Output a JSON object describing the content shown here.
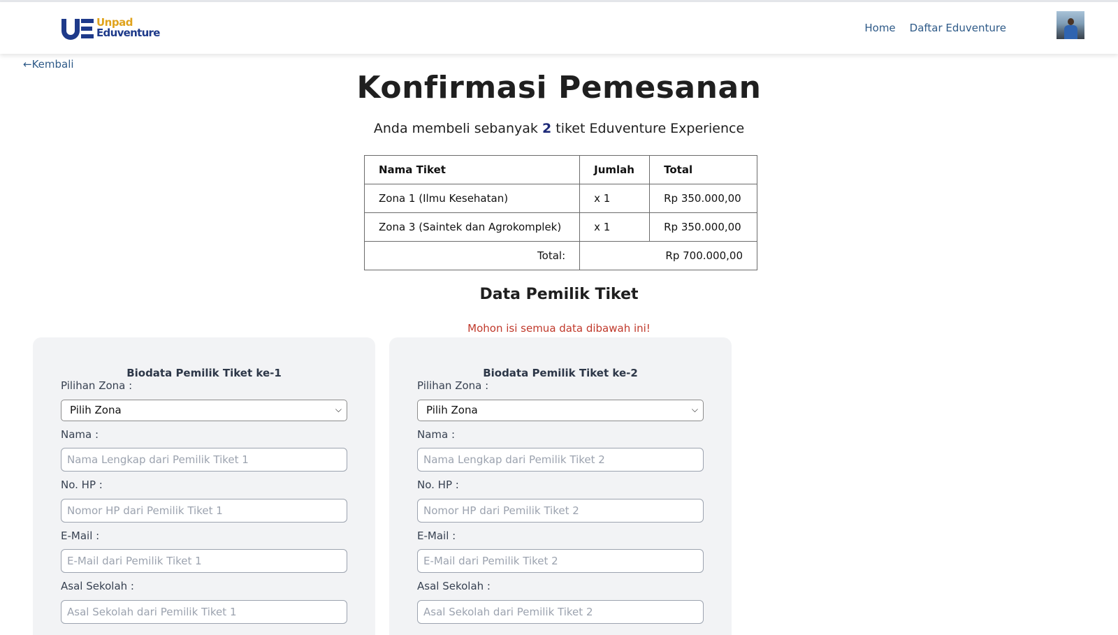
{
  "header": {
    "logo": {
      "line1": "Unpad",
      "line2": "Eduventure",
      "mark_text": "UE"
    },
    "nav": [
      "Home",
      "Daftar Eduventure"
    ]
  },
  "back_link": "←Kembali",
  "page_title": "Konfirmasi Pemesanan",
  "subtitle": {
    "before": "Anda membeli sebanyak",
    "quantity": "2",
    "after": "tiket Eduventure Experience"
  },
  "summary_table": {
    "headers": [
      "Nama Tiket",
      "Jumlah",
      "Total"
    ],
    "rows": [
      {
        "name": "Zona 1 (Ilmu Kesehatan)",
        "qty": "x 1",
        "total": "Rp 350.000,00"
      },
      {
        "name": "Zona 3 (Saintek dan Agrokomplek)",
        "qty": "x 1",
        "total": "Rp 350.000,00"
      }
    ],
    "total_label": "Total:",
    "total_value": "Rp 700.000,00"
  },
  "section_title": "Data Pemilik Tiket",
  "warning": "Mohon isi semua data dibawah ini!",
  "forms": [
    {
      "title": "Biodata Pemilik Tiket ke-1",
      "zone_label": "Pilihan Zona :",
      "zone_value": "Pilih Zona",
      "name_label": "Nama :",
      "name_placeholder": "Nama Lengkap dari Pemilik Tiket 1",
      "phone_label": "No. HP :",
      "phone_placeholder": "Nomor HP dari Pemilik Tiket 1",
      "email_label": "E-Mail :",
      "email_placeholder": "E-Mail dari Pemilik Tiket 1",
      "school_label": "Asal Sekolah :",
      "school_placeholder": "Asal Sekolah dari Pemilik Tiket 1"
    },
    {
      "title": "Biodata Pemilik Tiket ke-2",
      "zone_label": "Pilihan Zona :",
      "zone_value": "Pilih Zona",
      "name_label": "Nama :",
      "name_placeholder": "Nama Lengkap dari Pemilik Tiket 2",
      "phone_label": "No. HP :",
      "phone_placeholder": "Nomor HP dari Pemilik Tiket 2",
      "email_label": "E-Mail :",
      "email_placeholder": "E-Mail dari Pemilik Tiket 2",
      "school_label": "Asal Sekolah :",
      "school_placeholder": "Asal Sekolah dari Pemilik Tiket 2"
    }
  ],
  "colors": {
    "brand_navy": "#1e3a8a",
    "brand_gold": "#e0a31c",
    "link": "#2e5a88",
    "warning": "#c0392b"
  },
  "icons": {
    "select_arrow": "chevron-down-icon",
    "avatar": "user-avatar-photo"
  }
}
